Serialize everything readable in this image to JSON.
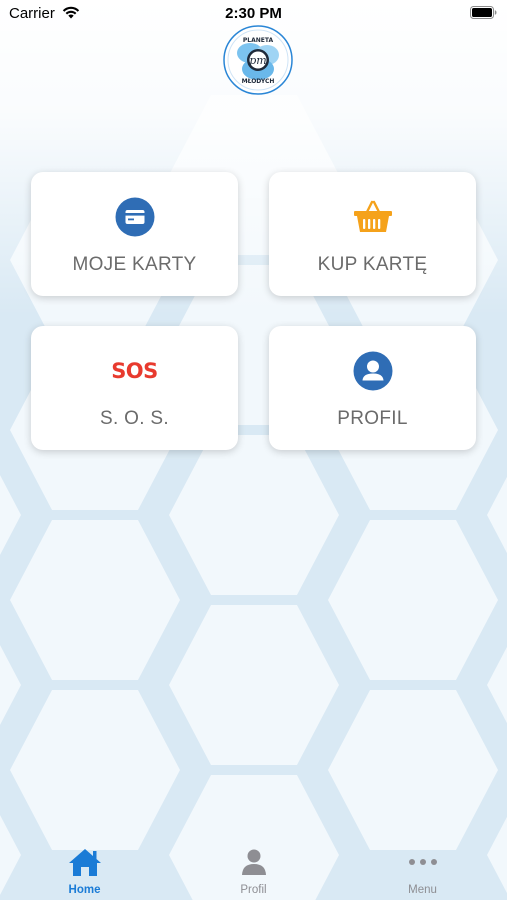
{
  "status_bar": {
    "carrier": "Carrier",
    "time": "2:30 PM"
  },
  "logo": {
    "icon": "planeta-mlodych-logo",
    "text_top": "PLANETA",
    "text_bottom": "MŁODYCH",
    "initials": "pm"
  },
  "tiles": [
    {
      "label": "MOJE KARTY",
      "icon": "credit-card-icon",
      "color": "#2f6db5"
    },
    {
      "label": "KUP KARTĘ",
      "icon": "basket-icon",
      "color": "#f5a21b"
    },
    {
      "label": "S. O. S.",
      "icon": "sos-icon",
      "icon_text": "SOS",
      "color": "#e83a2e"
    },
    {
      "label": "PROFIL",
      "icon": "user-icon",
      "color": "#2f6db5"
    }
  ],
  "tabbar": {
    "items": [
      {
        "label": "Home",
        "icon": "home-icon",
        "active": true
      },
      {
        "label": "Profil",
        "icon": "user-icon",
        "active": false
      },
      {
        "label": "Menu",
        "icon": "more-icon",
        "active": false
      }
    ],
    "active_color": "#1a7bd6",
    "inactive_color": "#8e8e93"
  }
}
